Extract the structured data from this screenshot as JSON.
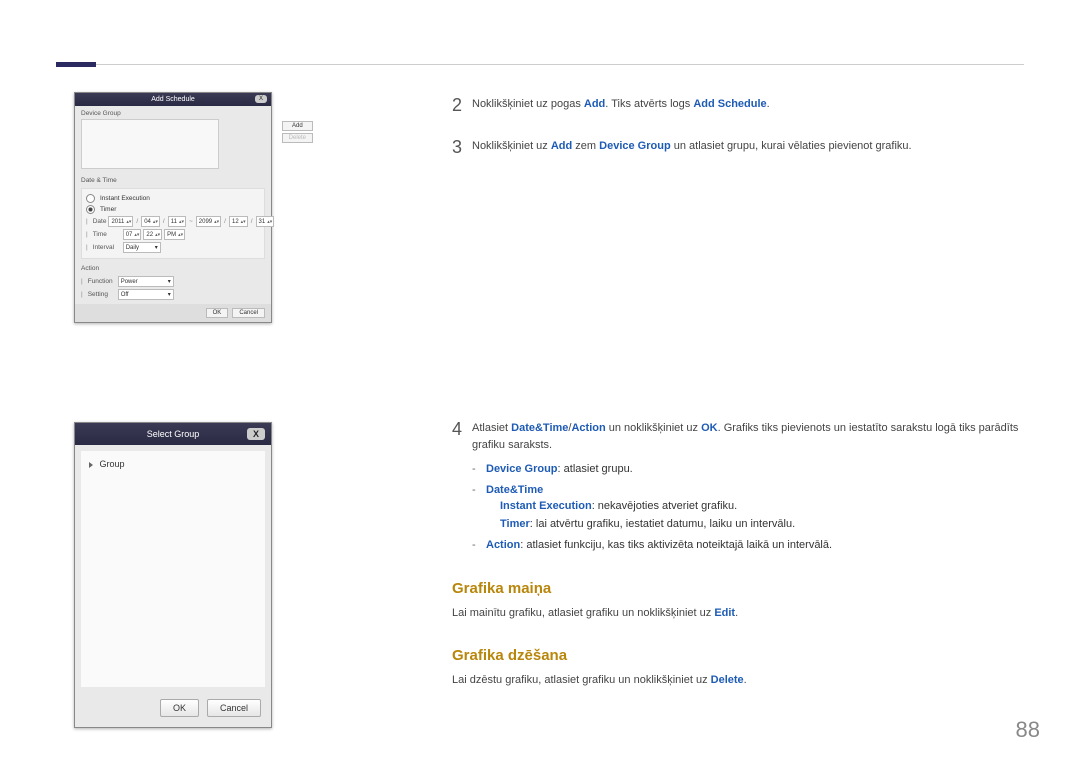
{
  "page_number": "88",
  "dlg1": {
    "title": "Add Schedule",
    "close": "X",
    "device_group_label": "Device Group",
    "add_btn": "Add",
    "delete_btn": "Delete",
    "datetime_label": "Date & Time",
    "instant_exec": "Instant Execution",
    "timer_radio": "Timer",
    "date_label": "Date",
    "date_y1": "2011",
    "date_m1": "04",
    "date_d1": "11",
    "date_tilde": "~",
    "date_y2": "2099",
    "date_m2": "12",
    "date_d2": "31",
    "time_label": "Time",
    "time_h": "07",
    "time_m": "22",
    "time_ampm": "PM",
    "interval_label": "Interval",
    "interval_val": "Daily",
    "action_label": "Action",
    "func_label": "Function",
    "func_val": "Power",
    "setting_label": "Setting",
    "setting_val": "Off",
    "ok": "OK",
    "cancel": "Cancel"
  },
  "dlg2": {
    "title": "Select Group",
    "close": "X",
    "tree_root": "Group",
    "ok": "OK",
    "cancel": "Cancel"
  },
  "step2": {
    "num": "2",
    "t1": "Noklikšķiniet uz pogas ",
    "add": "Add",
    "t2": ". Tiks atvērts logs ",
    "addsched": "Add Schedule",
    "t3": "."
  },
  "step3": {
    "num": "3",
    "t1": "Noklikšķiniet uz ",
    "add": "Add",
    "t2": " zem ",
    "dg": "Device Group",
    "t3": " un atlasiet grupu, kurai vēlaties pievienot grafiku."
  },
  "step4": {
    "num": "4",
    "t1": "Atlasiet ",
    "dt": "Date&Time",
    "slash": "/",
    "act": "Action",
    "t2": " un noklikšķiniet uz ",
    "ok": "OK",
    "t3": ". Grafiks tiks pievienots un iestatīto sarakstu logā tiks parādīts grafiku saraksts."
  },
  "b1": {
    "dg": "Device Group",
    "t": ": atlasiet grupu."
  },
  "b2": {
    "dt": "Date&Time",
    "ie": "Instant Execution",
    "ie_t": ": nekavējoties atveriet grafiku.",
    "tm": "Timer",
    "tm_t": ": lai atvērtu grafiku, iestatiet datumu, laiku un intervālu."
  },
  "b3": {
    "ac": "Action",
    "t": ":  atlasiet funkciju, kas tiks aktivizēta noteiktajā laikā un intervālā."
  },
  "h1": "Grafika maiņa",
  "p1a": "Lai mainītu grafiku, atlasiet grafiku un noklikšķiniet uz ",
  "p1b": "Edit",
  "p1c": ".",
  "h2": "Grafika dzēšana",
  "p2a": "Lai dzēstu grafiku, atlasiet grafiku un noklikšķiniet uz ",
  "p2b": "Delete",
  "p2c": "."
}
